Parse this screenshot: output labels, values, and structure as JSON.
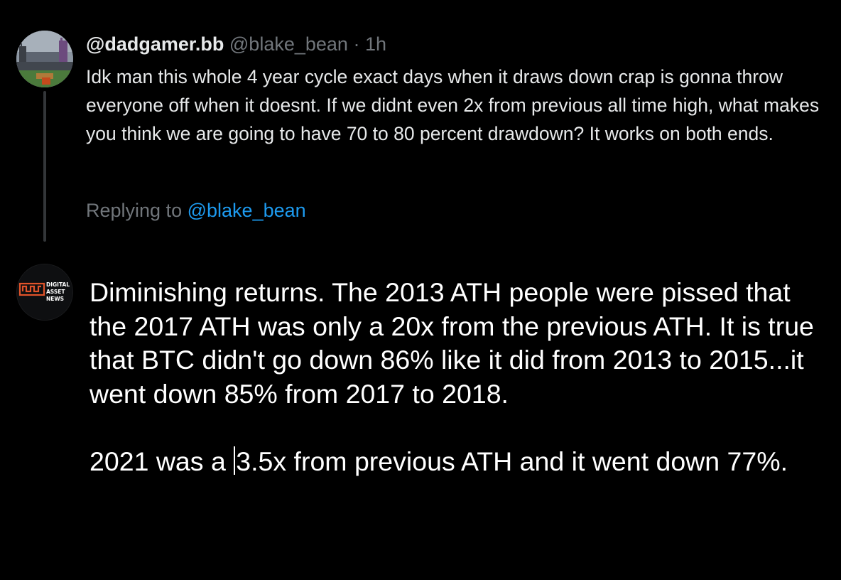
{
  "parent_tweet": {
    "display_name": "@dadgamer.bb",
    "handle": "@blake_bean",
    "separator": "·",
    "time": "1h",
    "avatar_icon": "stadium-photo-avatar",
    "body": "Idk man this whole 4 year cycle exact days when it draws down crap is gonna throw everyone off when it doesnt. If we didnt even 2x from previous all time high, what makes you think we are going to have 70 to 80 percent drawdown? It works on both ends.",
    "replying_prefix": "Replying to",
    "replying_mention": "@blake_bean"
  },
  "reply": {
    "avatar_icon": "digital-asset-news-logo-avatar",
    "avatar_logo_text": [
      "DIGITAL",
      "ASSET",
      "NEWS"
    ],
    "paragraph_1": "Diminishing returns. The 2013 ATH people were pissed that the 2017 ATH was only a 20x from the previous ATH.  It is true that BTC didn't go down 86% like it did from 2013 to 2015...it went down 85% from 2017 to 2018.",
    "paragraph_2_before_caret": "2021 was a ",
    "paragraph_2_after_caret": "3.5x from previous ATH and it went down 77%."
  },
  "colors": {
    "background": "#000000",
    "primary_text": "#e7e9ea",
    "secondary_text": "#71767b",
    "link": "#1d9bf0",
    "thread_line": "#333639"
  }
}
